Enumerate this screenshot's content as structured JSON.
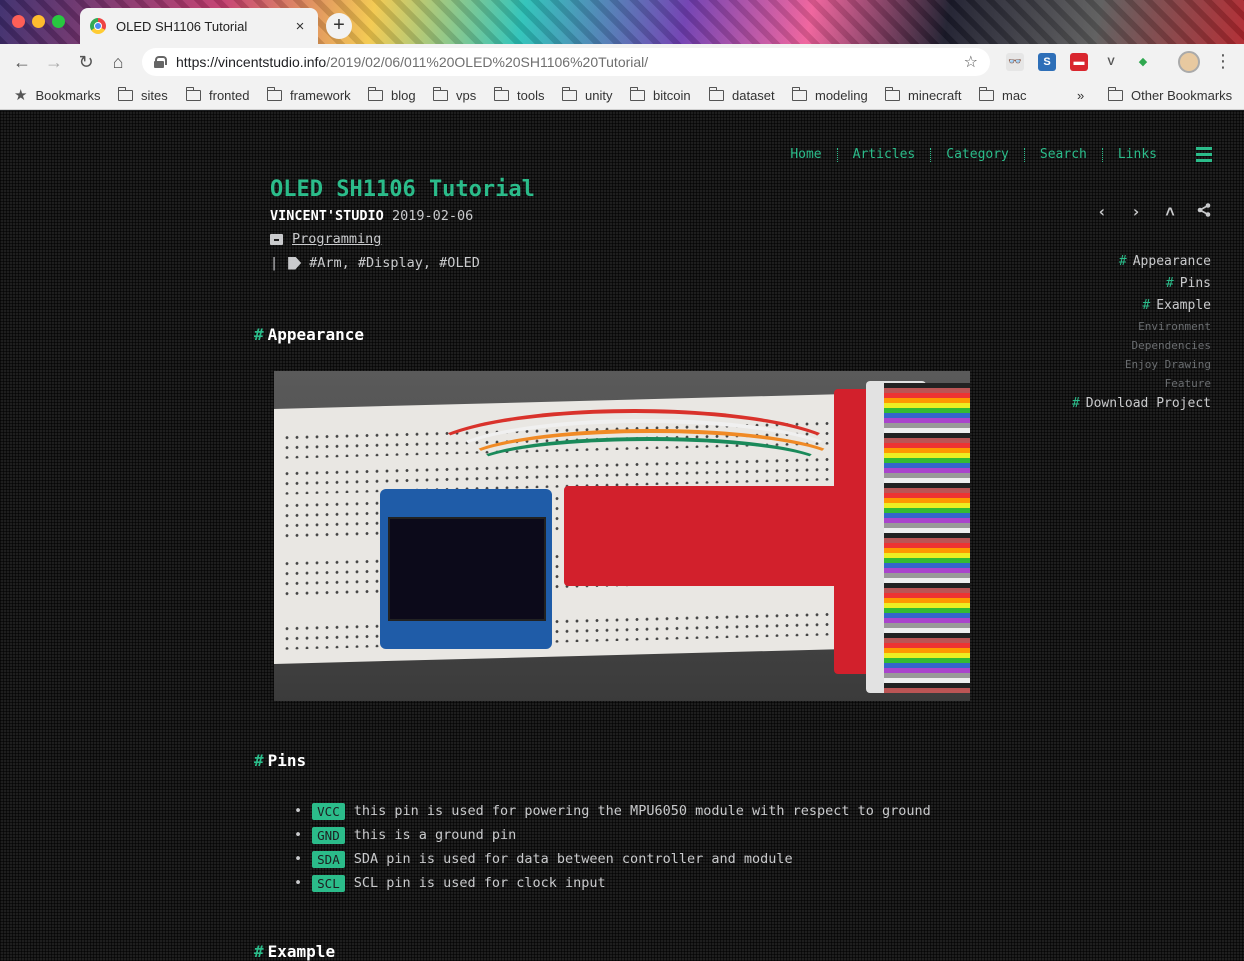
{
  "browser": {
    "tab_title": "OLED SH1106 Tutorial",
    "tab_close": "×",
    "new_tab": "+",
    "url_host": "https://vincentstudio.info",
    "url_path": "/2019/02/06/011%20OLED%20SH1106%20Tutorial/",
    "nav": {
      "back": "←",
      "forward": "→",
      "reload": "↻",
      "home": "⌂"
    },
    "menu": "⋮",
    "bookmarks_label": "Bookmarks",
    "bookmark_folders": [
      "sites",
      "fronted",
      "framework",
      "blog",
      "vps",
      "tools",
      "unity",
      "bitcoin",
      "dataset",
      "modeling",
      "minecraft",
      "mac"
    ],
    "overflow": "»",
    "other_bookmarks": "Other Bookmarks",
    "extensions": [
      "👓",
      "S",
      "▬",
      "V",
      "◆"
    ]
  },
  "site": {
    "nav": [
      "Home",
      "Articles",
      "Category",
      "Search",
      "Links"
    ],
    "accent": "#2bbc8a",
    "background": "#1e1e1e"
  },
  "post": {
    "title": "OLED SH1106 Tutorial",
    "author": "VINCENT'STUDIO",
    "date": "2019-02-06",
    "category": "Programming",
    "tag_separator": "|",
    "tags": "#Arm, #Display, #OLED",
    "actions": [
      "‹",
      "›",
      "˄",
      "share-icon"
    ]
  },
  "toc": {
    "items": [
      {
        "label": "Appearance",
        "level": 1
      },
      {
        "label": "Pins",
        "level": 1
      },
      {
        "label": "Example",
        "level": 1
      },
      {
        "label": "Environment",
        "level": 2
      },
      {
        "label": "Dependencies",
        "level": 2
      },
      {
        "label": "Enjoy Drawing",
        "level": 2
      },
      {
        "label": "Feature",
        "level": 2
      },
      {
        "label": "Download Project",
        "level": 1
      }
    ],
    "hash": "#"
  },
  "sections": {
    "hash": "#",
    "appearance": "Appearance",
    "pins": "Pins",
    "example": "Example"
  },
  "pins": [
    {
      "code": "VCC",
      "text": "this pin is used for powering the MPU6050 module with respect to ground"
    },
    {
      "code": "GND",
      "text": "this is a ground pin"
    },
    {
      "code": "SDA",
      "text": "SDA pin is used for data between controller and module"
    },
    {
      "code": "SCL",
      "text": "SCL pin is used for clock input"
    }
  ]
}
